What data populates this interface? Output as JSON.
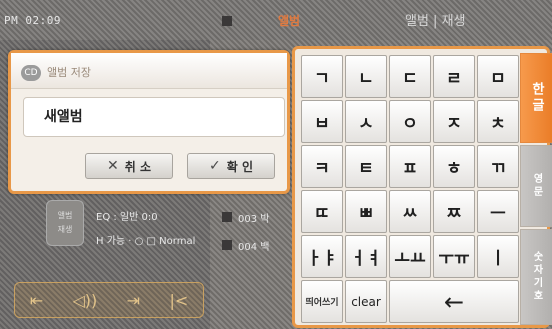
{
  "background": {
    "clock": "PM 02:09",
    "now_playing_title": "앨범",
    "menu_label": "앨범 | 재생",
    "badge_text": [
      "앨범",
      "재생"
    ],
    "track_info": "EQ : 일반 0:0",
    "track_detail": "H 가능  · ○ □ Normal",
    "list_items": [
      "003 박",
      "004 백"
    ],
    "controls": [
      "⇤",
      "◁))",
      "⇥",
      "|<"
    ]
  },
  "dialog": {
    "title": "앨범 저장",
    "icon_label": "CD",
    "input_value": "새앨범",
    "cancel_label": "취 소",
    "confirm_label": "확 인",
    "cancel_icon": "✕",
    "confirm_icon": "✓"
  },
  "keyboard": {
    "keys": [
      [
        "ㄱ",
        "ㄴ",
        "ㄷ",
        "ㄹ",
        "ㅁ"
      ],
      [
        "ㅂ",
        "ㅅ",
        "ㅇ",
        "ㅈ",
        "ㅊ"
      ],
      [
        "ㅋ",
        "ㅌ",
        "ㅍ",
        "ㅎ",
        "ㄲ"
      ],
      [
        "ㄸ",
        "ㅃ",
        "ㅆ",
        "ㅉ",
        "ㅡ"
      ],
      [
        "ㅏㅑ",
        "ㅓㅕ",
        "ㅗㅛ",
        "ㅜㅠ",
        "ㅣ"
      ]
    ],
    "space_label": "띄어쓰기",
    "clear_label": "clear",
    "backspace_label": "←",
    "tabs": {
      "hangul": "한글",
      "english": "영문",
      "number": "숫자기호"
    }
  }
}
